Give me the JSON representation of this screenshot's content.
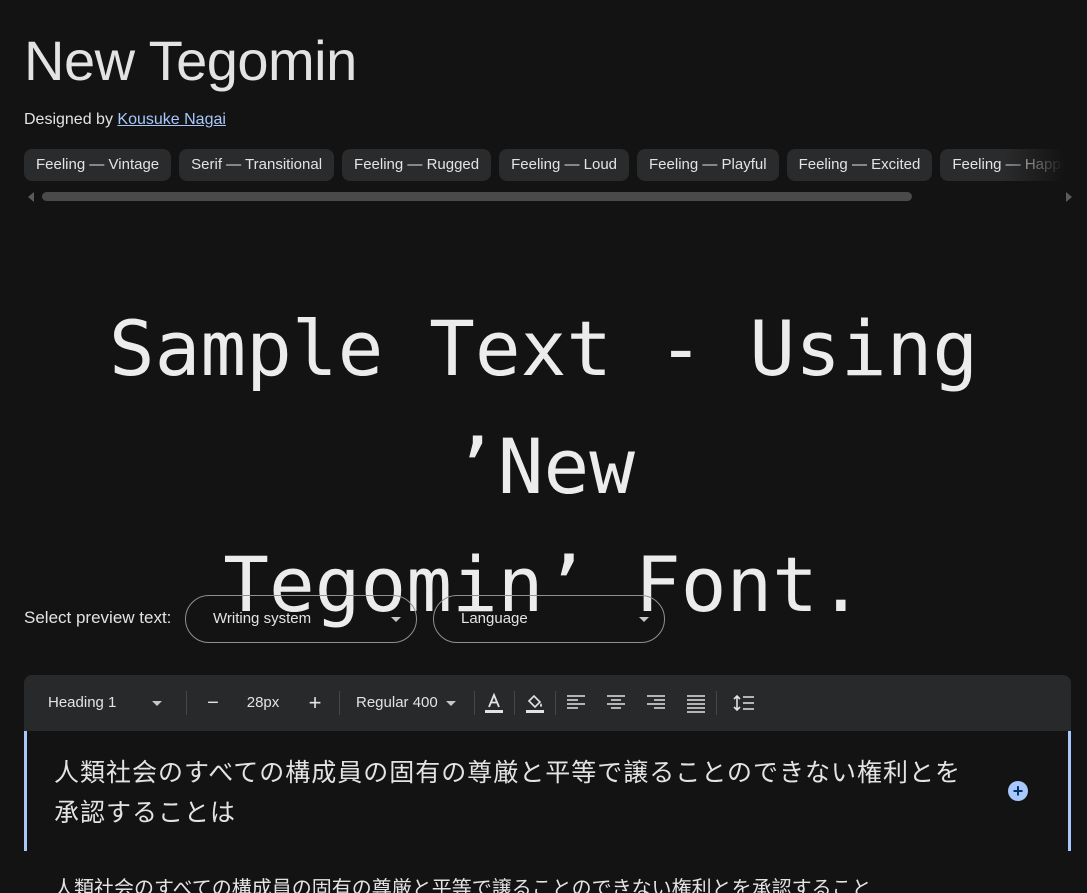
{
  "font": {
    "name": "New Tegomin",
    "designed_by_label": "Designed by",
    "designer": "Kousuke Nagai"
  },
  "tags": [
    "Feeling — Vintage",
    "Serif — Transitional",
    "Feeling — Rugged",
    "Feeling — Loud",
    "Feeling — Playful",
    "Feeling — Excited",
    "Feeling — Happy"
  ],
  "sample": {
    "line1": "Sample Text - Using ’New",
    "line2": "Tegomin’ Font."
  },
  "preview": {
    "label": "Select preview text:",
    "writing_system": "Writing system",
    "language": "Language"
  },
  "toolbar": {
    "style": "Heading 1",
    "decrease": "−",
    "size": "28px",
    "increase": "+",
    "weight": "Regular 400"
  },
  "editor": {
    "text": "人類社会のすべての構成員の固有の尊厳と平等で譲ることのできない権利とを承認することは",
    "next_text": "人類社会のすべての構成員の固有の尊厳と平等で譲ることのできない権利とを承認すること",
    "add": "+"
  },
  "colors": {
    "background": "#131313",
    "link": "#a8c7fa",
    "chip": "#2a2b2c",
    "toolbar": "#28292a"
  }
}
